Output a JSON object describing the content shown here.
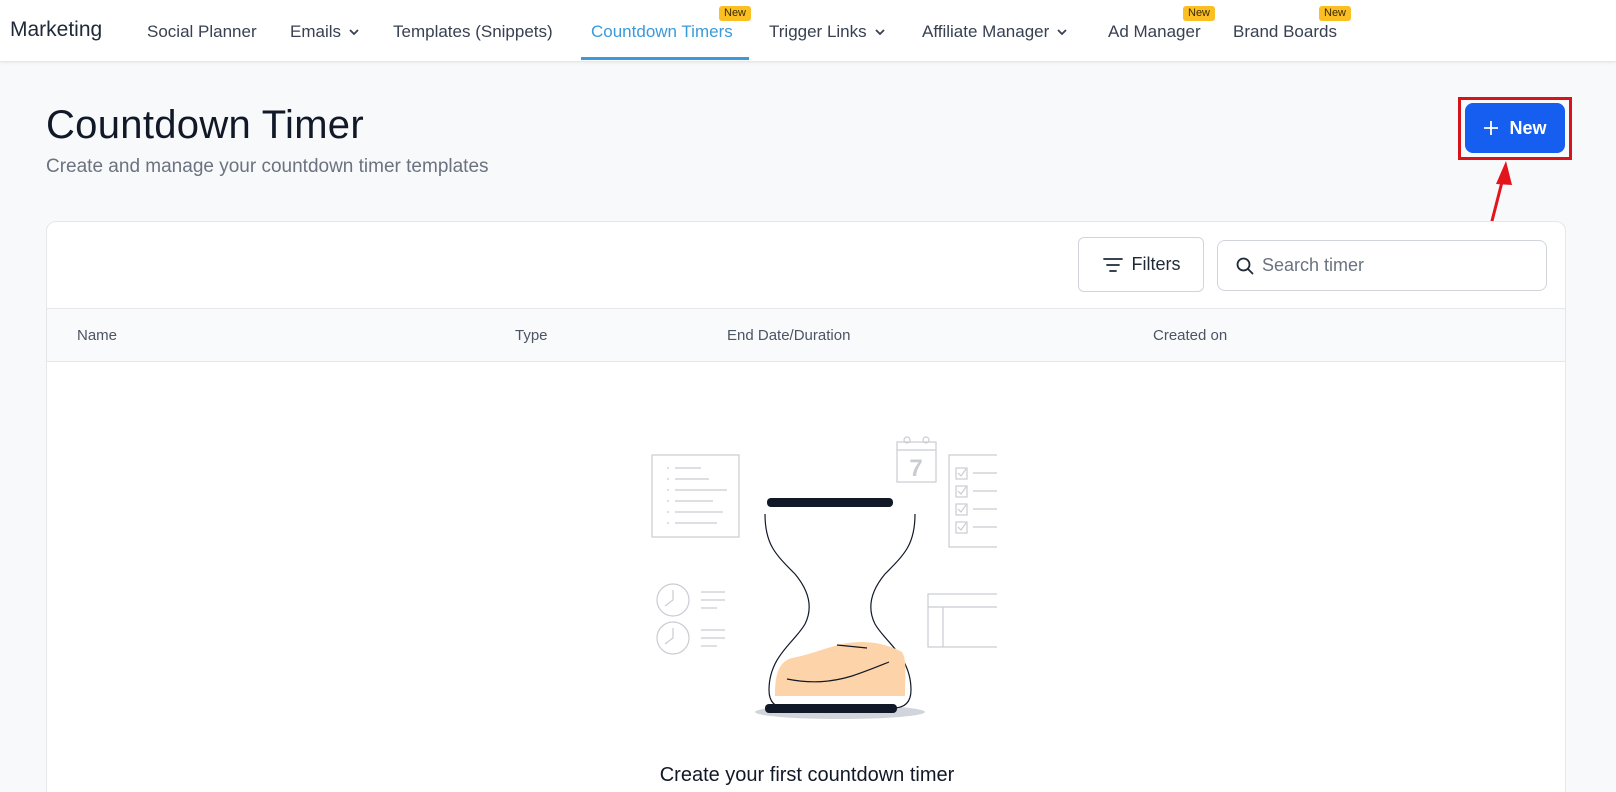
{
  "nav": {
    "brand": "Marketing",
    "items": [
      {
        "label": "Social Planner"
      },
      {
        "label": "Emails"
      },
      {
        "label": "Templates (Snippets)"
      },
      {
        "label": "Countdown Timers",
        "badge": "New",
        "active": true
      },
      {
        "label": "Trigger Links"
      },
      {
        "label": "Affiliate Manager"
      },
      {
        "label": "Ad Manager",
        "badge": "New"
      },
      {
        "label": "Brand Boards",
        "badge": "New"
      }
    ],
    "active_color": "#3b9ad9",
    "badge_color": "#fbbf24"
  },
  "header": {
    "title": "Countdown Timer",
    "subtitle": "Create and manage your countdown timer templates",
    "new_button_label": "New",
    "new_button_color": "#155eef",
    "highlight_color": "#d7141a"
  },
  "toolbar": {
    "filters_label": "Filters",
    "search_placeholder": "Search timer",
    "search_value": ""
  },
  "table": {
    "columns": [
      "Name",
      "Type",
      "End Date/Duration",
      "Created on"
    ]
  },
  "empty_state": {
    "title": "Create your first countdown timer",
    "calendar_number": "7",
    "sand_color": "#fdd4a9"
  }
}
